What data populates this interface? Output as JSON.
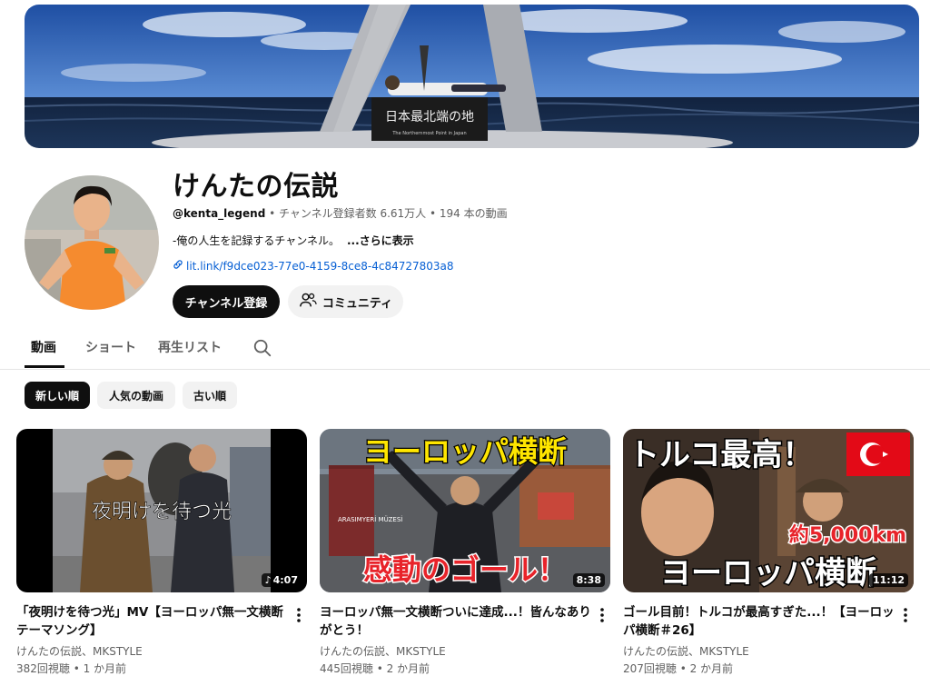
{
  "channel": {
    "name": "けんたの伝説",
    "handle": "@kenta_legend",
    "meta": " • チャンネル登録者数 6.61万人 • 194 本の動画",
    "description": "-俺の人生を記録するチャンネル。",
    "more": "...さらに表示",
    "link": "lit.link/f9dce023-77e0-4159-8ce8-4c84727803a8",
    "banner_sign": "日本最北端の地",
    "banner_sign_sub": "The Northernmost Point in Japan"
  },
  "buttons": {
    "subscribe": "チャンネル登録",
    "community": "コミュニティ"
  },
  "tabs": [
    {
      "label": "動画",
      "active": true
    },
    {
      "label": "ショート",
      "active": false
    },
    {
      "label": "再生リスト",
      "active": false
    }
  ],
  "chips": [
    {
      "label": "新しい順",
      "active": true
    },
    {
      "label": "人気の動画",
      "active": false
    },
    {
      "label": "古い順",
      "active": false
    }
  ],
  "videos": [
    {
      "title": "「夜明けを待つ光」MV【ヨーロッパ無一文横断テーマソング】",
      "channel": "けんたの伝説、MKSTYLE",
      "stats": "382回視聴 • 1 か月前",
      "duration": "4:07",
      "thumb_text": "夜明けを待つ光"
    },
    {
      "title": "ヨーロッパ無一文横断ついに達成...！皆んなありがとう！",
      "channel": "けんたの伝説、MKSTYLE",
      "stats": "445回視聴 • 2 か月前",
      "duration": "8:38",
      "thumb_text_top": "ヨーロッパ横断",
      "thumb_text_bottom": "感動のゴール！",
      "thumb_small": "ARASIMYERİ MÜZESİ"
    },
    {
      "title": "ゴール目前！トルコが最高すぎた...！【ヨーロッパ横断＃26】",
      "channel": "けんたの伝説、MKSTYLE",
      "stats": "207回視聴 • 2 か月前",
      "duration": "11:12",
      "thumb_text_top": "トルコ最高！",
      "thumb_text_mid": "約5,000km",
      "thumb_text_bottom": "ヨーロッパ横断"
    }
  ],
  "colors": {
    "link": "#065fd4",
    "accent_red": "#e8232a",
    "yellow": "#ffe600"
  }
}
